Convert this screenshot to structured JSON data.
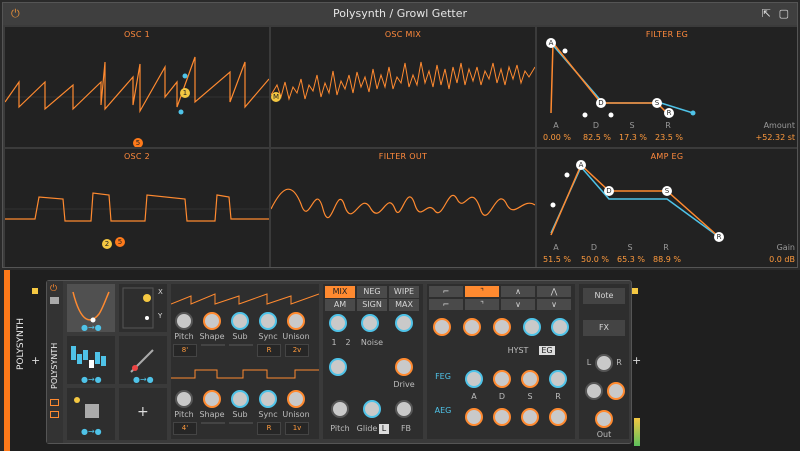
{
  "window": {
    "title": "Polysynth / Growl Getter"
  },
  "panels": {
    "osc1": {
      "title": "OSC 1",
      "marker1": "1",
      "marker2": "5"
    },
    "oscmix": {
      "title": "OSC MIX",
      "marker": "M"
    },
    "filtereg": {
      "title": "FILTER EG",
      "params": [
        {
          "label": "A",
          "value": "0.00 %"
        },
        {
          "label": "D",
          "value": "82.5 %"
        },
        {
          "label": "S",
          "value": "17.3 %"
        },
        {
          "label": "R",
          "value": "23.5 %"
        }
      ],
      "extra": {
        "label": "Amount",
        "value": "+52.32 st"
      },
      "points": [
        "A",
        "D",
        "S",
        "R"
      ]
    },
    "osc2": {
      "title": "OSC 2",
      "marker1": "2",
      "marker2": "5"
    },
    "filterout": {
      "title": "FILTER OUT"
    },
    "ampeg": {
      "title": "AMP EG",
      "params": [
        {
          "label": "A",
          "value": "51.5 %"
        },
        {
          "label": "D",
          "value": "50.0 %"
        },
        {
          "label": "S",
          "value": "65.3 %"
        },
        {
          "label": "R",
          "value": "88.9 %"
        }
      ],
      "extra": {
        "label": "Gain",
        "value": "0.0 dB"
      },
      "points": [
        "A",
        "D",
        "S",
        "R"
      ]
    }
  },
  "track": {
    "name": "POLYSYNTH",
    "device": "POLYSYNTH"
  },
  "osc_rows": [
    {
      "knobs": [
        "Pitch",
        "Shape",
        "Sub",
        "Sync",
        "Unison"
      ],
      "boxes": [
        "8'",
        "",
        "",
        "R",
        "2v"
      ]
    },
    {
      "knobs": [
        "Pitch",
        "Shape",
        "Sub",
        "Sync",
        "Unison"
      ],
      "boxes": [
        "4'",
        "",
        "",
        "R",
        "1v"
      ]
    }
  ],
  "mix_buttons": [
    {
      "label": "MIX",
      "on": true
    },
    {
      "label": "NEG",
      "on": false
    },
    {
      "label": "WIPE",
      "on": false
    },
    {
      "label": "AM",
      "on": false
    },
    {
      "label": "SIGN",
      "on": false
    },
    {
      "label": "MAX",
      "on": false
    }
  ],
  "mix_labels": {
    "one": "1",
    "two": "2",
    "noise": "Noise",
    "drive": "Drive",
    "pitch": "Pitch",
    "glide": "Glide",
    "glide_tag": "L",
    "fb": "FB"
  },
  "filter_labels": {
    "hyst": "HYST",
    "eg": "EG",
    "feg": "FEG",
    "aeg": "AEG",
    "adsr": [
      "A",
      "D",
      "S",
      "R"
    ]
  },
  "right": {
    "note": "Note",
    "fx": "FX",
    "out": "Out",
    "l": "L",
    "r": "R"
  },
  "xy": {
    "x": "X",
    "y": "Y"
  },
  "plus": "+"
}
